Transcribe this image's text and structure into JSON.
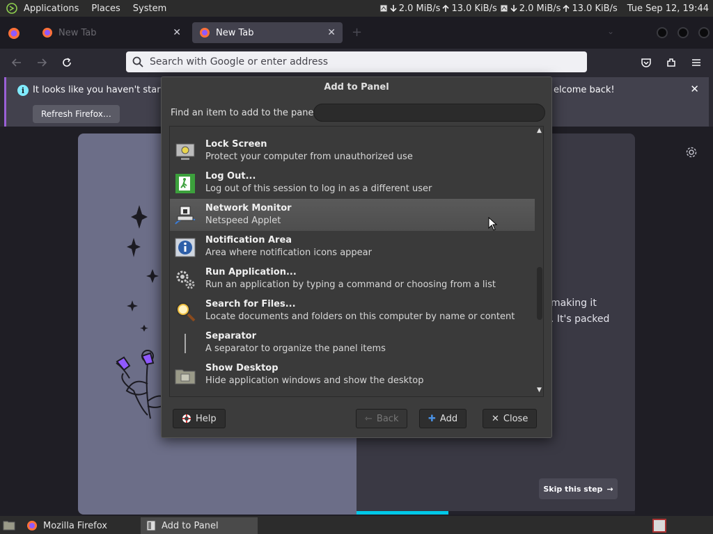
{
  "top_panel": {
    "menus": [
      "Applications",
      "Places",
      "System"
    ],
    "netspeed": [
      {
        "down": "2.0 MiB/s",
        "up": "13.0 KiB/s"
      },
      {
        "down": "2.0 MiB/s",
        "up": "13.0 KiB/s"
      }
    ],
    "clock": "Tue Sep 12, 19:44"
  },
  "browser": {
    "tabs": [
      {
        "title": "New Tab",
        "active": false
      },
      {
        "title": "New Tab",
        "active": true
      }
    ],
    "url_placeholder": "Search with Google or enter address",
    "notification": {
      "message": "It looks like you haven't started",
      "message_tail": "elcome back!",
      "button": "Refresh Firefox…"
    },
    "page": {
      "text_line_1": "making it",
      "text_line_2": ". It's packed",
      "skip_button": "Skip this step",
      "progress_fraction": 0.33
    }
  },
  "dialog": {
    "title": "Add to Panel",
    "find_label": "Find an item to add to the panel:",
    "find_value": "",
    "items": [
      {
        "name": "Lock Screen",
        "desc": "Protect your computer from unauthorized use",
        "icon": "lock-screen-icon"
      },
      {
        "name": "Log Out...",
        "desc": "Log out of this session to log in as a different user",
        "icon": "log-out-icon"
      },
      {
        "name": "Network Monitor",
        "desc": "Netspeed Applet",
        "icon": "network-monitor-icon",
        "selected": true
      },
      {
        "name": "Notification Area",
        "desc": "Area where notification icons appear",
        "icon": "info-icon"
      },
      {
        "name": "Run Application...",
        "desc": "Run an application by typing a command or choosing from a list",
        "icon": "gears-icon"
      },
      {
        "name": "Search for Files...",
        "desc": "Locate documents and folders on this computer by name or content",
        "icon": "magnifier-icon"
      },
      {
        "name": "Separator",
        "desc": "A separator to organize the panel items",
        "icon": "separator-icon"
      },
      {
        "name": "Show Desktop",
        "desc": "Hide application windows and show the desktop",
        "icon": "show-desktop-icon"
      }
    ],
    "buttons": {
      "help": "Help",
      "back": "Back",
      "add": "Add",
      "close": "Close"
    }
  },
  "taskbar": {
    "tasks": [
      {
        "label": "Mozilla Firefox",
        "active": false
      },
      {
        "label": "Add to Panel",
        "active": true
      }
    ]
  },
  "colors": {
    "accent": "#00c8e8",
    "notice_border": "#9a5fd6",
    "info": "#80ebff"
  }
}
